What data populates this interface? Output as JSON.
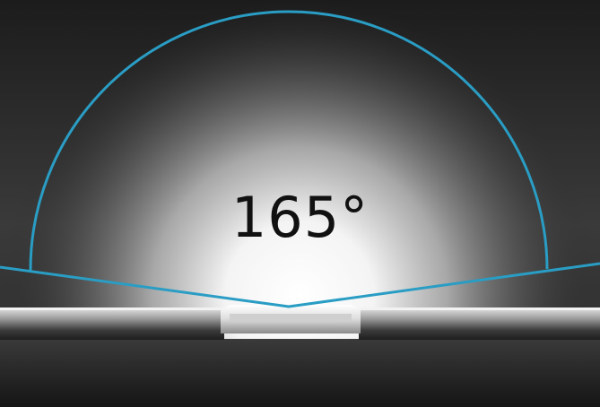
{
  "angle": {
    "label": "165°",
    "degrees": 165
  },
  "colors": {
    "arc": "#2a9dc4",
    "text": "#111111",
    "background": "#1a1a1a"
  }
}
